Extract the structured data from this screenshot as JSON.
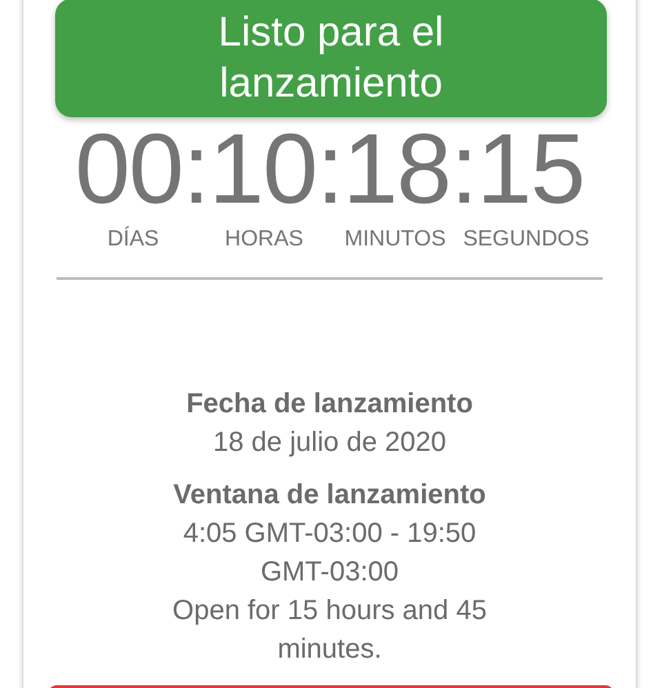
{
  "banner": {
    "text": "Listo para el lanzamiento"
  },
  "countdown": {
    "value": "00:10:18:15",
    "units": [
      "DÍAS",
      "HORAS",
      "MINUTOS",
      "SEGUNDOS"
    ]
  },
  "launch_date": {
    "label": "Fecha de lanzamiento",
    "value": "18 de julio de 2020"
  },
  "launch_window": {
    "label": "Ventana de lanzamiento",
    "value": "4:05 GMT-03:00 - 19:50 GMT-03:00",
    "duration": "Open for 15 hours and 45 minutes."
  }
}
